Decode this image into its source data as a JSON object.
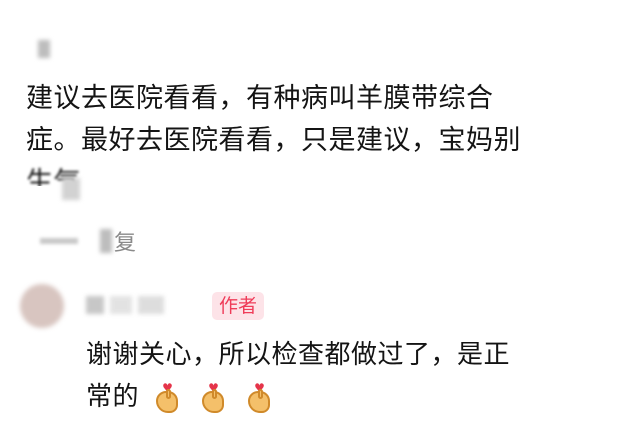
{
  "comment1": {
    "line1": "建议去医院看看，有种病叫羊膜带综合",
    "line2": "症。最好去医院看看，只是建议，宝妈别",
    "line3": "生气"
  },
  "reply": {
    "label": "复"
  },
  "reply2": {
    "badge": "作者",
    "line1": "谢谢关心，所以检查都做过了，是正",
    "line2": "常的",
    "emoji": [
      "heart-hands-icon",
      "heart-hands-icon",
      "heart-hands-icon"
    ]
  },
  "colors": {
    "badge_bg": "#fde3e8",
    "badge_text": "#ef3c59",
    "text": "#141414",
    "muted": "#8a8a8a"
  }
}
